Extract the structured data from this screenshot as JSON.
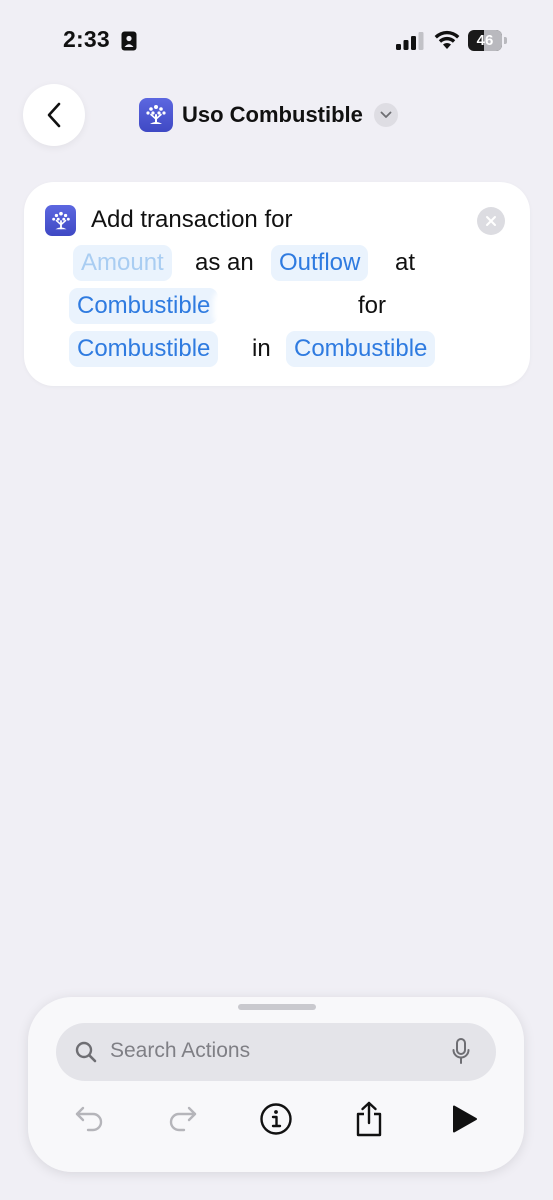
{
  "status_bar": {
    "time": "2:33",
    "battery_level": "46"
  },
  "nav": {
    "title": "Uso Combustible"
  },
  "action": {
    "line1": {
      "text": "Add transaction for"
    },
    "line2": {
      "amount_token": "Amount",
      "word1": "as an",
      "flow_token": "Outflow",
      "word2": "at"
    },
    "line3": {
      "payee_token": "Combustible",
      "word": "for"
    },
    "line4": {
      "category_token": "Combustible",
      "word": "in",
      "account_token": "Combustible"
    }
  },
  "toolbar": {
    "search_placeholder": "Search Actions"
  },
  "colors": {
    "accent": "#2f7be0",
    "token_bg": "#eaf3fd",
    "app_icon": "#4a55d3",
    "background": "#f0eff5"
  },
  "icons": [
    "back-chevron-icon",
    "app-tree-icon",
    "chevron-down-icon",
    "close-icon",
    "search-icon",
    "microphone-icon",
    "undo-icon",
    "redo-icon",
    "info-icon",
    "share-icon",
    "play-icon"
  ]
}
